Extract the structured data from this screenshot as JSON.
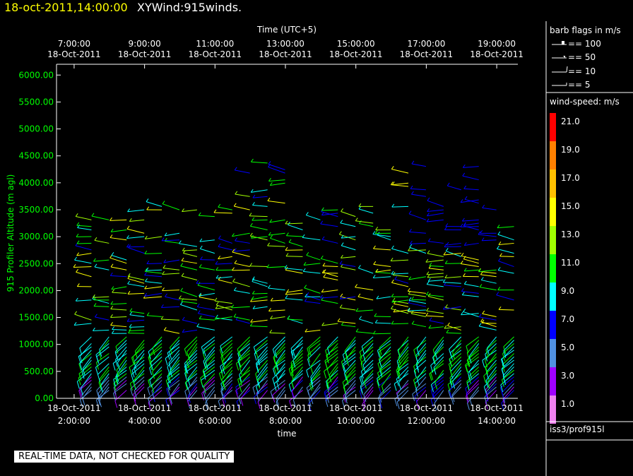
{
  "header": {
    "datetime": "18-oct-2011,14:00:00",
    "title": "XYWind:915winds."
  },
  "chart_data": {
    "type": "scatter",
    "subtype": "wind-barb time-height",
    "top_axis": {
      "label": "Time (UTC+5)",
      "ticks": [
        {
          "time": "7:00:00",
          "date": "18-Oct-2011"
        },
        {
          "time": "9:00:00",
          "date": "18-Oct-2011"
        },
        {
          "time": "11:00:00",
          "date": "18-Oct-2011"
        },
        {
          "time": "13:00:00",
          "date": "18-Oct-2011"
        },
        {
          "time": "15:00:00",
          "date": "18-Oct-2011"
        },
        {
          "time": "17:00:00",
          "date": "18-Oct-2011"
        },
        {
          "time": "19:00:00",
          "date": "18-Oct-2011"
        }
      ]
    },
    "bottom_axis": {
      "label": "time",
      "ticks": [
        {
          "date": "18-Oct-2011",
          "time": "2:00:00"
        },
        {
          "date": "18-Oct-2011",
          "time": "4:00:00"
        },
        {
          "date": "18-Oct-2011",
          "time": "6:00:00"
        },
        {
          "date": "18-Oct-2011",
          "time": "8:00:00"
        },
        {
          "date": "18-Oct-2011",
          "time": "10:00:00"
        },
        {
          "date": "18-Oct-2011",
          "time": "12:00:00"
        },
        {
          "date": "18-Oct-2011",
          "time": "14:00:00"
        }
      ],
      "xlim_hours": [
        1.5,
        14.6
      ]
    },
    "y_axis": {
      "label": "915 Profiler Altitude (m agl)",
      "ylim": [
        0,
        6200
      ],
      "ticks": [
        "0.00",
        "500.00",
        "1000.00",
        "1500.00",
        "2000.00",
        "2500.00",
        "3000.00",
        "3500.00",
        "4000.00",
        "4500.00",
        "5000.00",
        "5500.00",
        "6000.00"
      ]
    },
    "profile_hours": [
      2.25,
      2.75,
      3.25,
      3.75,
      4.25,
      4.75,
      5.25,
      5.75,
      6.25,
      6.75,
      7.25,
      7.75,
      8.25,
      8.75,
      9.25,
      9.75,
      10.25,
      10.75,
      11.25,
      11.75,
      12.25,
      12.75,
      13.25,
      13.75,
      14.25
    ],
    "legend": {
      "barb_title": "barb flags in m/s",
      "barbs": [
        {
          "label": "== 100"
        },
        {
          "label": "== 50"
        },
        {
          "label": "== 10"
        },
        {
          "label": "== 5"
        }
      ],
      "speed_title": "wind-speed: m/s",
      "speed_scale": [
        {
          "value": "21.0",
          "color": "#ff0000"
        },
        {
          "value": "19.0",
          "color": "#ff8000"
        },
        {
          "value": "17.0",
          "color": "#ffc000"
        },
        {
          "value": "15.0",
          "color": "#ffff00"
        },
        {
          "value": "13.0",
          "color": "#a0ff00"
        },
        {
          "value": "11.0",
          "color": "#00ff00"
        },
        {
          "value": "9.0",
          "color": "#00ffff"
        },
        {
          "value": "7.0",
          "color": "#0000ff"
        },
        {
          "value": "5.0",
          "color": "#5090e0"
        },
        {
          "value": "3.0",
          "color": "#a000ff"
        },
        {
          "value": "1.0",
          "color": "#ee80ee"
        }
      ]
    }
  },
  "footer": {
    "qc_notice": "REAL-TIME DATA, NOT CHECKED FOR QUALITY",
    "station": "iss3/prof915l"
  }
}
